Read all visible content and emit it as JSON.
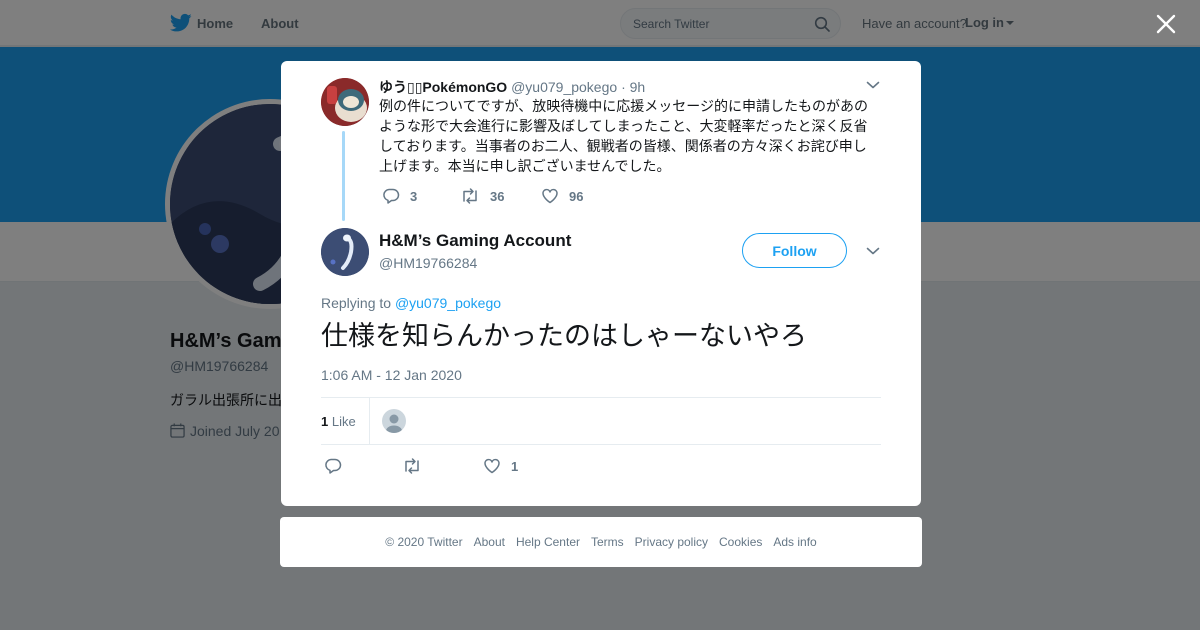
{
  "nav": {
    "logo_icon": "twitter-bird-icon",
    "home": "Home",
    "about": "About",
    "search_placeholder": "Search Twitter",
    "have_account": "Have an account?",
    "login": "Log in"
  },
  "profile": {
    "name": "H&M’s Gam",
    "handle": "@HM19766284",
    "bio": "ガラル出張所に出",
    "joined": "Joined July 20"
  },
  "parent_tweet": {
    "author_name": "ゆう▯▯PokémonGO",
    "handle": "@yu079_pokego",
    "separator": "·",
    "age": "9h",
    "text": "例の件についてですが、放映待機中に応援メッセージ的に申請したものがあのような形で大会進行に影響及ぼしてしまったこと、大変軽率だったと深く反省しております。当事者のお二人、観戦者の皆様、関係者の方々深くお詫び申し上げます。本当に申し訳ございませんでした。",
    "replies": "3",
    "retweets": "36",
    "likes": "96"
  },
  "tweet": {
    "author_name": "H&M’s Gaming Account",
    "handle": "@HM19766284",
    "follow_label": "Follow",
    "replying_prefix": "Replying to",
    "replying_to": "@yu079_pokego",
    "text": "仕様を知らんかったのはしゃーないやろ",
    "timestamp": "1:06 AM - 12 Jan 2020",
    "like_count": "1",
    "like_label": "Like",
    "likes": "1"
  },
  "footer": {
    "links": [
      "© 2020 Twitter",
      "About",
      "Help Center",
      "Terms",
      "Privacy policy",
      "Cookies",
      "Ads info"
    ]
  },
  "colors": {
    "accent": "#1da1f2",
    "thread_line": "#a6d8f8",
    "muted_text": "#657786"
  }
}
